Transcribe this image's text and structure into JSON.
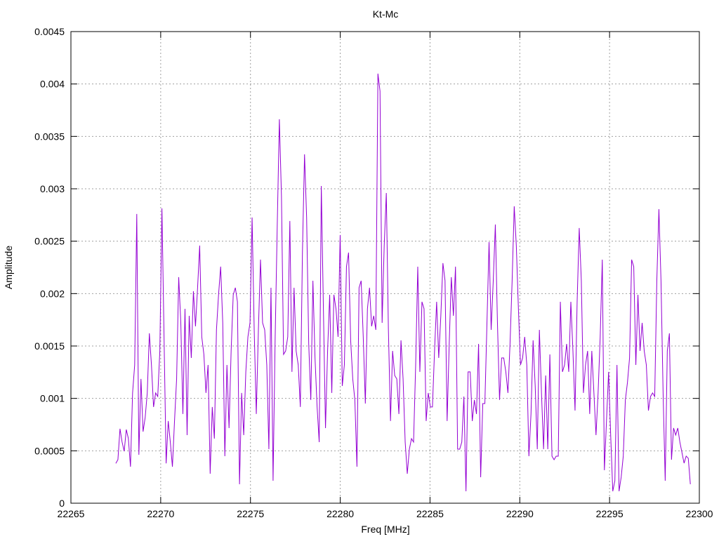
{
  "chart_data": {
    "type": "line",
    "title": "Kt-Mc",
    "xlabel": "Freq [MHz]",
    "ylabel": "Amplitude",
    "xlim": [
      22265,
      22300
    ],
    "ylim": [
      0,
      0.0045
    ],
    "grid": true,
    "legend": "none",
    "x_ticks": [
      "22265",
      "22270",
      "22275",
      "22280",
      "22285",
      "22290",
      "22295",
      "22300"
    ],
    "x_tick_values": [
      22265,
      22270,
      22275,
      22280,
      22285,
      22290,
      22295,
      22300
    ],
    "y_ticks": [
      "0",
      "0.0005",
      "0.001",
      "0.0015",
      "0.002",
      "0.0025",
      "0.003",
      "0.0035",
      "0.004",
      "0.0045"
    ],
    "y_tick_values": [
      0,
      0.0005,
      0.001,
      0.0015,
      0.002,
      0.0025,
      0.003,
      0.0035,
      0.004,
      0.0045
    ],
    "series": [
      {
        "name": "Kt-Mc",
        "color": "#9400d3",
        "x_start": 22267.5,
        "x_end": 22299.5,
        "values": [
          0.00038,
          0.000415,
          0.00071,
          0.000583,
          0.000496,
          0.000703,
          0.000616,
          0.000348,
          0.001052,
          0.001319,
          0.00276,
          0.000462,
          0.001186,
          0.000683,
          0.000817,
          0.001052,
          0.001621,
          0.001319,
          0.000918,
          0.001052,
          0.001018,
          0.001453,
          0.002813,
          0.001587,
          0.00038,
          0.000784,
          0.000583,
          0.000348,
          0.000784,
          0.001186,
          0.002157,
          0.001721,
          0.000851,
          0.001855,
          0.00065,
          0.001788,
          0.001386,
          0.002023,
          0.001688,
          0.002056,
          0.002458,
          0.001587,
          0.00142,
          0.001052,
          0.001319,
          0.000281,
          0.000918,
          0.000616,
          0.001654,
          0.001989,
          0.002257,
          0.001721,
          0.000449,
          0.001319,
          0.000717,
          0.001453,
          0.001989,
          0.002056,
          0.001922,
          0.000181,
          0.001052,
          0.00065,
          0.001253,
          0.001587,
          0.001721,
          0.002726,
          0.001654,
          0.000851,
          0.001654,
          0.002324,
          0.001721,
          0.001654,
          0.001319,
          0.000516,
          0.002056,
          0.000214,
          0.001587,
          0.002659,
          0.003664,
          0.002927,
          0.00142,
          0.001453,
          0.001587,
          0.002693,
          0.001253,
          0.002056,
          0.001453,
          0.001319,
          0.000918,
          0.002391,
          0.003329,
          0.002726,
          0.00152,
          0.000985,
          0.002123,
          0.001386,
          0.000918,
          0.000583,
          0.003027,
          0.001855,
          0.000717,
          0.001453,
          0.001989,
          0.001052,
          0.001989,
          0.001855,
          0.001587,
          0.002559,
          0.001119,
          0.001319,
          0.002257,
          0.002391,
          0.001554,
          0.001186,
          0.000985,
          0.000348,
          0.002056,
          0.002123,
          0.001587,
          0.000951,
          0.001855,
          0.002056,
          0.001688,
          0.001788,
          0.001654,
          0.004099,
          0.003932,
          0.001721,
          0.002458,
          0.00296,
          0.001654,
          0.000784,
          0.001453,
          0.001219,
          0.001186,
          0.000851,
          0.001554,
          0.001186,
          0.000583,
          0.000281,
          0.000516,
          0.000616,
          0.000583,
          0.001319,
          0.002257,
          0.001253,
          0.001922,
          0.001855,
          0.000784,
          0.001052,
          0.000918,
          0.000918,
          0.001453,
          0.001922,
          0.001386,
          0.001788,
          0.002291,
          0.002123,
          0.000784,
          0.00152,
          0.002157,
          0.001788,
          0.002257,
          0.000516,
          0.000516,
          0.000583,
          0.001018,
          0.000114,
          0.001253,
          0.001253,
          0.000784,
          0.000985,
          0.000851,
          0.00152,
          0.000248,
          0.000951,
          0.000951,
          0.001721,
          0.002492,
          0.001654,
          0.002123,
          0.002659,
          0.001721,
          0.000985,
          0.001386,
          0.001386,
          0.001253,
          0.001052,
          0.00152,
          0.002123,
          0.002833,
          0.002458,
          0.001855,
          0.001319,
          0.001386,
          0.001587,
          0.001319,
          0.000449,
          0.000851,
          0.001554,
          0.001119,
          0.000516,
          0.001654,
          0.001052,
          0.000516,
          0.001219,
          0.000516,
          0.00142,
          0.000449,
          0.000415,
          0.000449,
          0.000449,
          0.001922,
          0.001253,
          0.001319,
          0.00152,
          0.001253,
          0.001922,
          0.001453,
          0.000884,
          0.001922,
          0.002626,
          0.002123,
          0.001052,
          0.001319,
          0.001453,
          0.000851,
          0.001453,
          0.001052,
          0.00065,
          0.001052,
          0.001587,
          0.002324,
          0.000315,
          0.000784,
          0.001253,
          0.00065,
          0.000114,
          0.000214,
          0.001319,
          0.000114,
          0.000248,
          0.000449,
          0.000985,
          0.001152,
          0.001386,
          0.002324,
          0.002257,
          0.001319,
          0.001989,
          0.001453,
          0.001721,
          0.001453,
          0.001319,
          0.000884,
          0.001018,
          0.001052,
          0.001018,
          0.002123,
          0.002806,
          0.002123,
          0.001052,
          0.000214,
          0.001453,
          0.001621,
          0.000415,
          0.000717,
          0.00065,
          0.000717,
          0.000583,
          0.000482,
          0.000382,
          0.000449,
          0.000429,
          0.000181
        ]
      }
    ]
  }
}
